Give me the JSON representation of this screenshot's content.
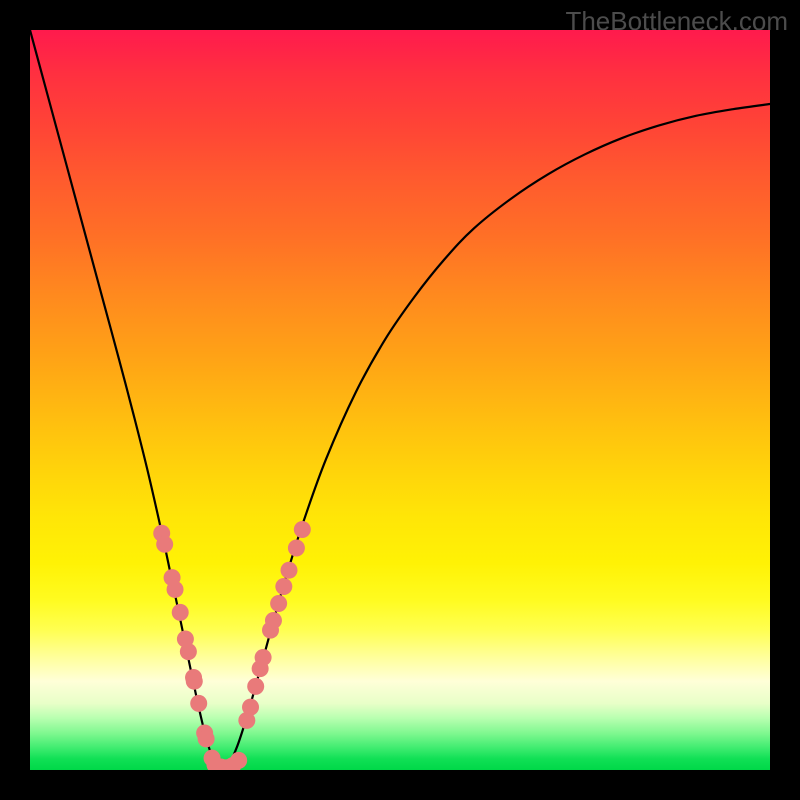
{
  "watermark": "TheBottleneck.com",
  "colors": {
    "curve_stroke": "#000000",
    "dot_fill": "#e97a7a",
    "dot_stroke": "#c24f4f",
    "background_frame": "#000000"
  },
  "chart_data": {
    "type": "line",
    "title": "",
    "xlabel": "",
    "ylabel": "",
    "xlim": [
      0,
      1
    ],
    "ylim": [
      0,
      1
    ],
    "minimum_x": 0.26,
    "series": [
      {
        "name": "bottleneck-curve",
        "x": [
          0.0,
          0.02,
          0.04,
          0.06,
          0.08,
          0.1,
          0.12,
          0.14,
          0.16,
          0.18,
          0.19,
          0.2,
          0.21,
          0.22,
          0.23,
          0.24,
          0.25,
          0.26,
          0.27,
          0.28,
          0.29,
          0.3,
          0.31,
          0.33,
          0.35,
          0.37,
          0.4,
          0.44,
          0.48,
          0.52,
          0.56,
          0.6,
          0.65,
          0.7,
          0.75,
          0.8,
          0.85,
          0.9,
          0.95,
          1.0
        ],
        "y": [
          1.0,
          0.926,
          0.852,
          0.778,
          0.704,
          0.63,
          0.556,
          0.48,
          0.4,
          0.312,
          0.265,
          0.218,
          0.17,
          0.122,
          0.076,
          0.036,
          0.01,
          0.0,
          0.01,
          0.032,
          0.062,
          0.096,
          0.132,
          0.205,
          0.274,
          0.337,
          0.42,
          0.51,
          0.582,
          0.64,
          0.69,
          0.732,
          0.772,
          0.805,
          0.832,
          0.854,
          0.871,
          0.884,
          0.893,
          0.9
        ]
      }
    ],
    "highlight_points": {
      "name": "observed-points",
      "left": {
        "x": [
          0.178,
          0.182,
          0.192,
          0.196,
          0.203,
          0.21,
          0.214,
          0.221,
          0.222,
          0.228,
          0.236,
          0.238,
          0.246
        ],
        "y": [
          0.32,
          0.305,
          0.26,
          0.244,
          0.213,
          0.177,
          0.16,
          0.125,
          0.12,
          0.09,
          0.05,
          0.042,
          0.016
        ]
      },
      "bottom": {
        "x": [
          0.25,
          0.258,
          0.266,
          0.274,
          0.282
        ],
        "y": [
          0.007,
          0.004,
          0.003,
          0.006,
          0.013
        ]
      },
      "right": {
        "x": [
          0.293,
          0.298,
          0.305,
          0.311,
          0.315,
          0.325,
          0.329,
          0.336,
          0.343,
          0.35,
          0.36,
          0.368
        ],
        "y": [
          0.067,
          0.085,
          0.113,
          0.137,
          0.152,
          0.189,
          0.202,
          0.225,
          0.248,
          0.27,
          0.3,
          0.325
        ]
      }
    }
  }
}
